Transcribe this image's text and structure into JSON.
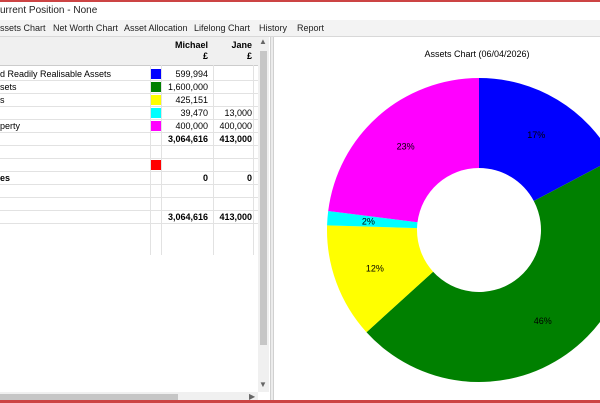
{
  "window": {
    "title": "urrent Position - None"
  },
  "tabs": [
    "ssets Chart",
    "Net Worth Chart",
    "Asset Allocation",
    "Lifelong Chart",
    "History",
    "Report"
  ],
  "table": {
    "columns": [
      {
        "name": "Michael",
        "unit": "£"
      },
      {
        "name": "Jane",
        "unit": "£"
      }
    ],
    "rows": [
      {
        "label": "d Readily Realisable Assets",
        "color": "#0000ff",
        "v1": "599,994",
        "v2": "",
        "bold": false
      },
      {
        "label": "sets",
        "color": "#008000",
        "v1": "1,600,000",
        "v2": "",
        "bold": false
      },
      {
        "label": "s",
        "color": "#ffff00",
        "v1": "425,151",
        "v2": "",
        "bold": false
      },
      {
        "label": "",
        "color": "#00ffff",
        "v1": "39,470",
        "v2": "13,000",
        "bold": false
      },
      {
        "label": "perty",
        "color": "#ff00ff",
        "v1": "400,000",
        "v2": "400,000",
        "bold": false
      },
      {
        "label": "",
        "color": "",
        "v1": "3,064,616",
        "v2": "413,000",
        "bold": true
      },
      {
        "label": "",
        "color": "",
        "v1": "",
        "v2": "",
        "bold": false
      },
      {
        "label": "",
        "color": "#ff0000",
        "v1": "",
        "v2": "",
        "bold": false
      },
      {
        "label": "es",
        "color": "",
        "v1": "0",
        "v2": "0",
        "bold": true
      },
      {
        "label": "",
        "color": "",
        "v1": "",
        "v2": "",
        "bold": false
      },
      {
        "label": "",
        "color": "",
        "v1": "",
        "v2": "",
        "bold": false
      },
      {
        "label": "",
        "color": "",
        "v1": "3,064,616",
        "v2": "413,000",
        "bold": true
      }
    ]
  },
  "chart_data": {
    "type": "pie",
    "title": "Assets Chart (06/04/2026)",
    "donut": true,
    "slices": [
      {
        "value": 599994,
        "color": "#0000ff",
        "label": "17%"
      },
      {
        "value": 1600000,
        "color": "#008000",
        "label": "46%"
      },
      {
        "value": 425151,
        "color": "#ffff00",
        "label": "12%"
      },
      {
        "value": 52470,
        "color": "#00ffff",
        "label": "2%"
      },
      {
        "value": 800000,
        "color": "#ff00ff",
        "label": "23%"
      }
    ]
  }
}
